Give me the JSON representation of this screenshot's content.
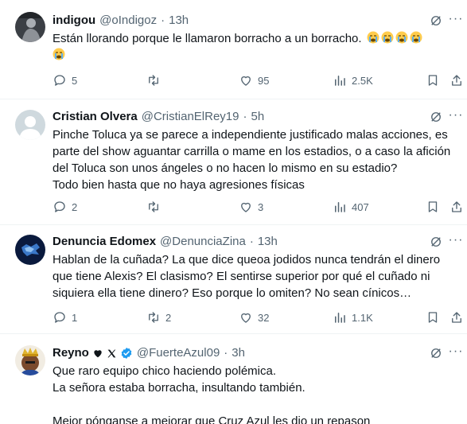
{
  "tweets": [
    {
      "name": "indigou",
      "handle": "@oIndigoz",
      "sep": "·",
      "time": "13h",
      "lines": [
        "Están llorando porque le llamaron borracho a un borracho."
      ],
      "replies": "5",
      "retweets": "",
      "likes": "95",
      "views": "2.5K",
      "avatar": "dark-figure"
    },
    {
      "name": "Cristian Olvera",
      "handle": "@CristianElRey19",
      "sep": "·",
      "time": "5h",
      "lines": [
        "Pinche Toluca ya se parece a independiente justificado malas acciones, es",
        "parte del show aguantar carrilla o mame en los estadios, o a caso la afición",
        "del Toluca son unos ángeles o no hacen lo mismo en su estadio?",
        "Todo bien hasta que no haya agresiones físicas"
      ],
      "replies": "2",
      "retweets": "",
      "likes": "3",
      "views": "407",
      "avatar": "default"
    },
    {
      "name": "Denuncia Edomex",
      "handle": "@DenunciaZina",
      "sep": "·",
      "time": "13h",
      "lines": [
        "Hablan de la cuñada? La que dice queoa jodidos nunca tendrán el dinero",
        "que tiene Alexis? El clasismo? El sentirse superior por qué el cuñado ni",
        "siquiera ella tiene dinero? Eso porque lo omiten? No sean cínicos…"
      ],
      "replies": "1",
      "retweets": "2",
      "likes": "32",
      "views": "1.1K",
      "avatar": "blue-map"
    },
    {
      "name": "Reyno",
      "handle": "@FuerteAzul09",
      "sep": "·",
      "time": "3h",
      "lines": [
        "Que raro equipo chico haciendo polémica.",
        "La señora estaba borracha, insultando también.",
        "",
        "Mejor pónganse a mejorar que Cruz Azul les dio un repason"
      ],
      "avatar": "crowned"
    }
  ],
  "colors": {
    "text": "#0f1419",
    "muted": "#536471",
    "verified": "#1d9bf0",
    "divider": "#eff3f4"
  },
  "icons": {
    "reply": "reply-icon",
    "retweet": "retweet-icon",
    "like": "like-icon",
    "views": "views-icon",
    "bookmark": "bookmark-icon",
    "share": "share-icon",
    "grok": "grok-icon",
    "more": "more-icon"
  }
}
